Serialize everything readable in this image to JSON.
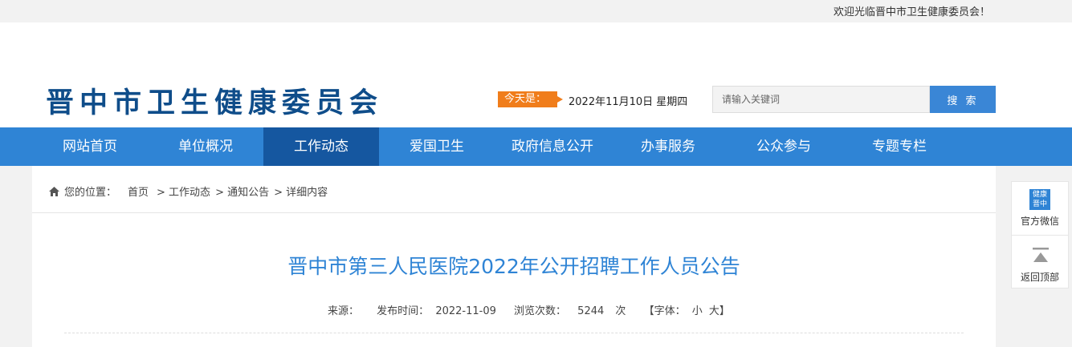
{
  "topbar": {
    "welcome": "欢迎光临晋中市卫生健康委员会！"
  },
  "header": {
    "site_name": "晋中市卫生健康委员会",
    "today_label": "今天是：",
    "today_date": "2022年11月10日 星期四",
    "search_placeholder": "请输入关键词",
    "search_button": "搜 索"
  },
  "nav": {
    "items": [
      {
        "label": "网站首页"
      },
      {
        "label": "单位概况"
      },
      {
        "label": "工作动态",
        "active": true
      },
      {
        "label": "爱国卫生"
      },
      {
        "label": "政府信息公开"
      },
      {
        "label": "办事服务"
      },
      {
        "label": "公众参与"
      },
      {
        "label": "专题专栏"
      }
    ]
  },
  "breadcrumb": {
    "prefix": "您的位置：",
    "items": [
      "首页",
      "> 工作动态",
      "> 通知公告",
      "> 详细内容"
    ]
  },
  "article": {
    "title": "晋中市第三人民医院2022年公开招聘工作人员公告",
    "source_label": "来源：",
    "publish_label": "发布时间：",
    "publish_date": "2022-11-09",
    "views_label": "浏览次数：",
    "views_count": "5244",
    "views_unit": "次",
    "font_label": "【字体：",
    "font_small": "小",
    "font_large": "大】"
  },
  "float_panel": {
    "wechat_icon_text": "健康晋中",
    "wechat_label": "官方微信",
    "totop_label": "返回顶部"
  },
  "colors": {
    "nav_bg": "#2f84d5",
    "nav_active": "#1557a0",
    "logo": "#0f4d8a",
    "today_badge": "#f07d1b",
    "title": "#2f84d5"
  }
}
